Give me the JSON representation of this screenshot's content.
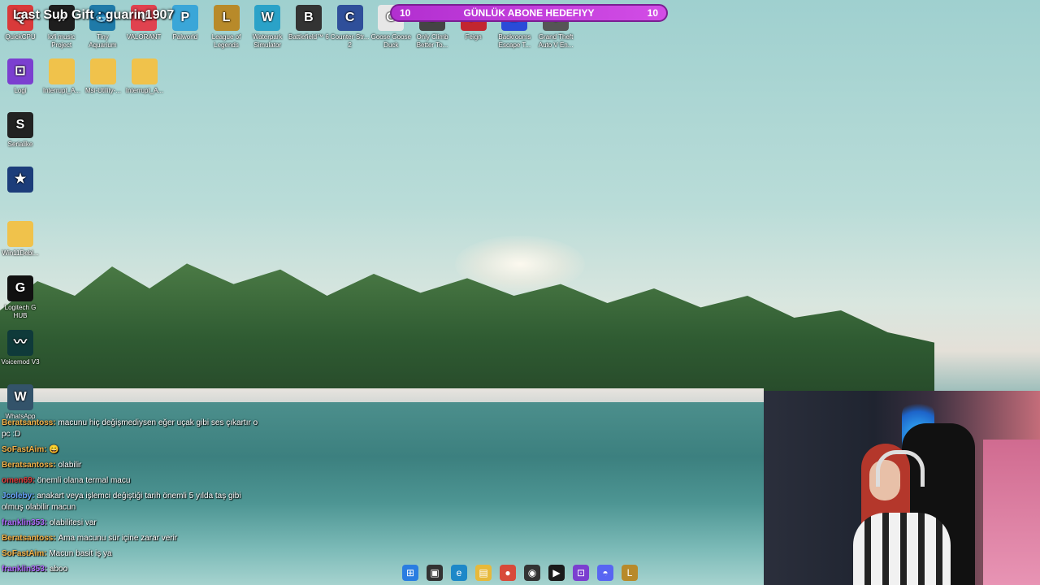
{
  "overlay": {
    "last_sub": "Last Sub Gift : guarin1907",
    "goal": {
      "left_count": "10",
      "title": "GÜNLÜK ABONE HEDEFIYY",
      "right_count": "10"
    }
  },
  "desktop_icons": [
    {
      "label": "QuickCPU",
      "icon": "quickcpu-icon",
      "color": "#d93a3a",
      "glyph": "Q"
    },
    {
      "label": "lofi music Project",
      "icon": "lofi-icon",
      "color": "#1e1e1e",
      "glyph": "♫"
    },
    {
      "label": "Tiny Aquarium",
      "icon": "aquarium-icon",
      "color": "#1f7aa8",
      "glyph": "🐟"
    },
    {
      "label": "VALORANT",
      "icon": "valorant-icon",
      "color": "#e0424f",
      "glyph": "V"
    },
    {
      "label": "Palworld",
      "icon": "palworld-icon",
      "color": "#3aa6d8",
      "glyph": "P"
    },
    {
      "label": "League of Legends",
      "icon": "lol-icon",
      "color": "#b88a2a",
      "glyph": "L"
    },
    {
      "label": "Waterpark Simulator",
      "icon": "waterpark-icon",
      "color": "#2aa2c8",
      "glyph": "W"
    },
    {
      "label": "Battlefield™ 6",
      "icon": "battlefield-icon",
      "color": "#333",
      "glyph": "B"
    },
    {
      "label": "Counter-Str... 2",
      "icon": "cs2-icon",
      "color": "#2f4f9a",
      "glyph": "C"
    },
    {
      "label": "Goose Goose Duck",
      "icon": "goose-icon",
      "color": "#e7e7e7",
      "glyph": "G"
    },
    {
      "label": "Only Climb Better To...",
      "icon": "onlyclimb-icon",
      "color": "#444",
      "glyph": "O"
    },
    {
      "label": "Feign",
      "icon": "feign-icon",
      "color": "#c2262f",
      "glyph": "F"
    },
    {
      "label": "Backrooms Escape T...",
      "icon": "backrooms-icon",
      "color": "#2a4bd8",
      "glyph": "B"
    },
    {
      "label": "Grand Theft Auto V En...",
      "icon": "gta-icon",
      "color": "#555",
      "glyph": "V"
    }
  ],
  "desktop_icons_row2": [
    {
      "label": "Logi",
      "icon": "logi-icon",
      "color": "#7b3fd0",
      "glyph": "⊡"
    },
    {
      "label": "Interrupt_A...",
      "icon": "folder-icon",
      "color": "#f0c24b",
      "glyph": ""
    },
    {
      "label": "Msi-Utility-...",
      "icon": "folder-icon",
      "color": "#f0c24b",
      "glyph": ""
    },
    {
      "label": "Interrupt_A...",
      "icon": "folder-icon",
      "color": "#f0c24b",
      "glyph": ""
    }
  ],
  "desktop_icons_col": [
    {
      "label": "Serialike",
      "icon": "serialike-icon",
      "color": "#222",
      "glyph": "S"
    },
    {
      "label": "",
      "icon": "game-icon",
      "color": "#1c3d7a",
      "glyph": "★"
    },
    {
      "label": "Win11Debl...",
      "icon": "folder-icon",
      "color": "#f0c24b",
      "glyph": ""
    },
    {
      "label": "Logitech G HUB",
      "icon": "ghub-icon",
      "color": "#111",
      "glyph": "G"
    },
    {
      "label": "Voicemod V3",
      "icon": "voicemod-icon",
      "color": "#0f3a3a",
      "glyph": "〰"
    },
    {
      "label": "WhatsApp",
      "icon": "whatsapp-icon",
      "color": "#33536a",
      "glyph": "W"
    }
  ],
  "chat": [
    {
      "user": "Beratsantoss:",
      "user_color": "#f2b24a",
      "text": "macunu hiç değişmediysen eğer uçak gibi ses çıkartır o pc :D"
    },
    {
      "user": "SoFastAim:",
      "user_color": "#f2b24a",
      "text": "😄"
    },
    {
      "user": "Beratsantoss:",
      "user_color": "#f2b24a",
      "text": "olabilir"
    },
    {
      "user": "omen69:",
      "user_color": "#e23b3b",
      "text": "önemli olana termal macu"
    },
    {
      "user": "Jcoleby:",
      "user_color": "#6aa6ff",
      "text": "anakart veya işlemci değiştiği tarih önemli 5 yılda taş gibi olmuş olabilir macun"
    },
    {
      "user": "franklin353:",
      "user_color": "#b06cff",
      "text": "olabilitesi var"
    },
    {
      "user": "Beratsantoss:",
      "user_color": "#f2b24a",
      "text": "Ama macunu sür içine zarar verir"
    },
    {
      "user": "SoFastAim:",
      "user_color": "#f2b24a",
      "text": "Macun basit iş ya"
    },
    {
      "user": "franklin353:",
      "user_color": "#b06cff",
      "text": "aboo"
    }
  ],
  "taskbar": [
    {
      "name": "windows-start-icon",
      "glyph": "⊞",
      "color": "#2a7de1"
    },
    {
      "name": "task-view-icon",
      "glyph": "▣",
      "color": "#333"
    },
    {
      "name": "edge-icon",
      "glyph": "e",
      "color": "#1e88c8"
    },
    {
      "name": "file-explorer-icon",
      "glyph": "▤",
      "color": "#e7b93b"
    },
    {
      "name": "chrome-icon",
      "glyph": "●",
      "color": "#d84a3a"
    },
    {
      "name": "obs-icon",
      "glyph": "◉",
      "color": "#333"
    },
    {
      "name": "nvidia-icon",
      "glyph": "▶",
      "color": "#1a1a1a"
    },
    {
      "name": "logi-icon",
      "glyph": "⊡",
      "color": "#7b3fd0"
    },
    {
      "name": "discord-icon",
      "glyph": "◓",
      "color": "#5865f2"
    },
    {
      "name": "league-icon",
      "glyph": "L",
      "color": "#b88a2a"
    }
  ]
}
